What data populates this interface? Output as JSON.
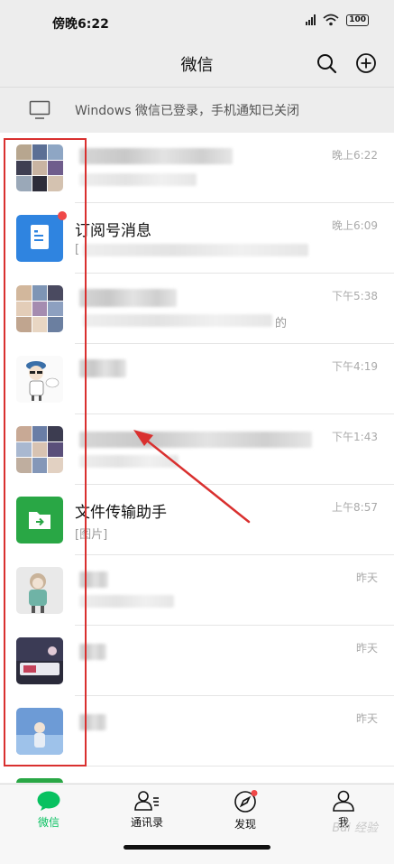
{
  "status_bar": {
    "time": "傍晚6:22",
    "battery": "100"
  },
  "header": {
    "title": "微信"
  },
  "notice": {
    "text": "Windows 微信已登录，手机通知已关闭"
  },
  "chats": [
    {
      "name": "",
      "preview": "",
      "time": "晚上6:22",
      "avatar": "photo-collage-avatar"
    },
    {
      "name": "订阅号消息",
      "preview": "[",
      "time": "晚上6:09",
      "avatar": "subscription-avatar",
      "unread_dot": true
    },
    {
      "name": "",
      "preview": "的",
      "time": "下午5:38",
      "avatar": "photo-collage-avatar"
    },
    {
      "name": "",
      "preview": "",
      "time": "下午4:19",
      "avatar": "cartoon-avatar"
    },
    {
      "name": "",
      "preview": "",
      "time": "下午1:43",
      "avatar": "photo-collage-avatar"
    },
    {
      "name": "文件传输助手",
      "preview": "[图片]",
      "time": "上午8:57",
      "avatar": "file-transfer-avatar"
    },
    {
      "name": "",
      "preview": "",
      "time": "昨天",
      "avatar": "anime-girl-avatar"
    },
    {
      "name": "",
      "preview": "",
      "time": "昨天",
      "avatar": "photo-avatar"
    },
    {
      "name": "",
      "preview": "",
      "time": "昨天",
      "avatar": "blue-photo-avatar"
    }
  ],
  "tabs": [
    {
      "label": "微信",
      "icon": "chat-icon",
      "active": true
    },
    {
      "label": "通讯录",
      "icon": "contacts-icon",
      "active": false
    },
    {
      "label": "发现",
      "icon": "compass-icon",
      "active": false,
      "dot": true
    },
    {
      "label": "我",
      "icon": "person-icon",
      "active": false
    }
  ],
  "watermark": "Bai 经验",
  "colors": {
    "accent": "#07c160",
    "annotation": "#d9302f",
    "unread": "#f04848"
  }
}
